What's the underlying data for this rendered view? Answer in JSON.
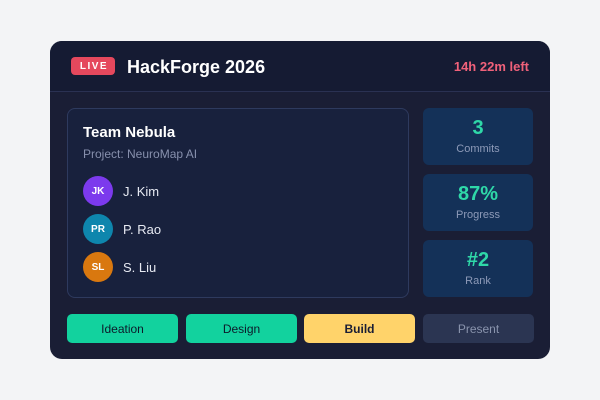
{
  "header": {
    "live_badge": "LIVE",
    "title": "HackForge 2026",
    "time_left": "14h 22m left"
  },
  "team": {
    "name": "Team Nebula",
    "project": "Project: NeuroMap AI",
    "members": [
      {
        "initials": "JK",
        "name": "J. Kim",
        "color": "#7c3aed"
      },
      {
        "initials": "PR",
        "name": "P. Rao",
        "color": "#0e86ad"
      },
      {
        "initials": "SL",
        "name": "S. Liu",
        "color": "#d9780f"
      }
    ]
  },
  "stats": [
    {
      "value": "3",
      "label": "Commits"
    },
    {
      "value": "87%",
      "label": "Progress"
    },
    {
      "value": "#2",
      "label": "Rank"
    }
  ],
  "phases": [
    {
      "label": "Ideation",
      "state": "done"
    },
    {
      "label": "Design",
      "state": "done"
    },
    {
      "label": "Build",
      "state": "active"
    },
    {
      "label": "Present",
      "state": "pending"
    }
  ],
  "colors": {
    "accent_green": "#12d29e",
    "accent_yellow": "#ffd36a",
    "live_red": "#e5485d",
    "card_bg": "#1a1e35"
  }
}
